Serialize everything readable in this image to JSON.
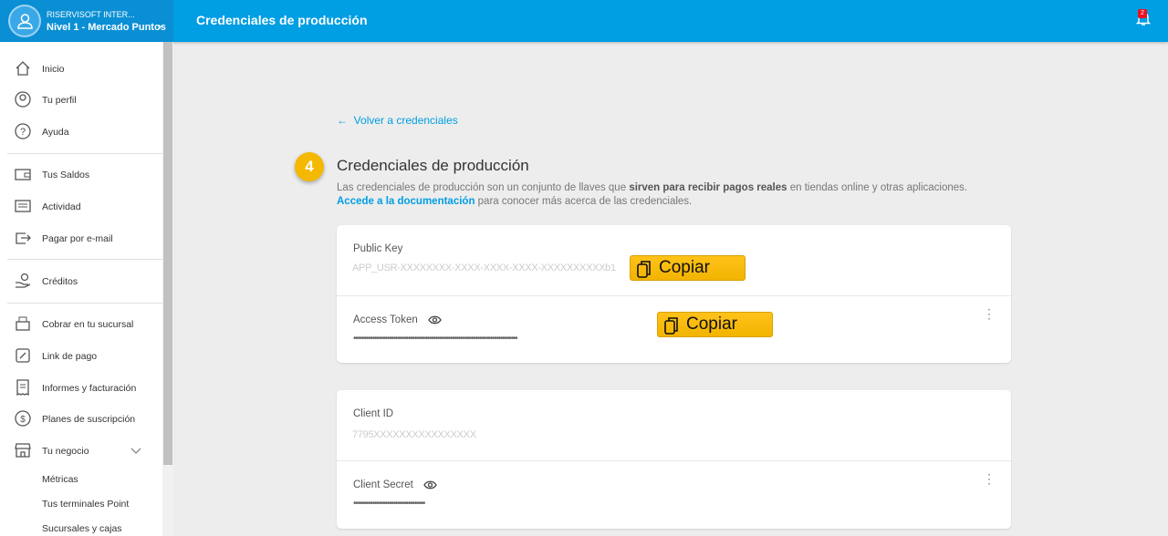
{
  "header": {
    "account_name": "RISERVISOFT INTER...",
    "account_level": "Nivel 1 - Mercado Puntos",
    "title": "Credenciales de producción",
    "notifications": "2",
    "brand_color": "#009ee3"
  },
  "sidebar": {
    "items": [
      {
        "label": "Inicio",
        "icon": "home-icon"
      },
      {
        "label": "Tu perfil",
        "icon": "profile-icon"
      },
      {
        "label": "Ayuda",
        "icon": "help-icon"
      },
      {
        "label": "Tus Saldos",
        "icon": "wallet-icon"
      },
      {
        "label": "Actividad",
        "icon": "activity-icon"
      },
      {
        "label": "Pagar por e-mail",
        "icon": "send-icon"
      },
      {
        "label": "Créditos",
        "icon": "credit-icon"
      },
      {
        "label": "Cobrar en tu sucursal",
        "icon": "register-icon"
      },
      {
        "label": "Link de pago",
        "icon": "link-icon"
      },
      {
        "label": "Informes y facturación",
        "icon": "receipt-icon"
      },
      {
        "label": "Planes de suscripción",
        "icon": "subscription-icon"
      },
      {
        "label": "Tu negocio",
        "icon": "store-icon"
      }
    ],
    "subitems": [
      "Métricas",
      "Tus terminales Point",
      "Sucursales y cajas"
    ]
  },
  "main": {
    "back_link": "Volver a credenciales",
    "step": "4",
    "title": "Credenciales de producción",
    "desc_1": "Las credenciales de producción son un conjunto de llaves que ",
    "desc_bold": "sirven para recibir pagos reales",
    "desc_2": " en tiendas online y otras aplicaciones.",
    "doc_link": "Accede a la documentación",
    "desc_3": " para conocer más acerca de las credenciales.",
    "public_key_label": "Public Key",
    "public_key_value": "APP_USR-XXXXXXXX-XXXX-XXXX-XXXX-XXXXXXXXXXb1",
    "access_token_label": "Access Token",
    "access_token_value": "••••••••••••••••••••••••••••••••••••••••••••••••••••••••••••••••••••••••••••••",
    "copy_label": "Copiar",
    "client_id_label": "Client ID",
    "client_id_value": "7795XXXXXXXXXXXXXXXX",
    "client_secret_label": "Client Secret",
    "client_secret_value": "••••••••••••••••••••••••••••••••••"
  }
}
